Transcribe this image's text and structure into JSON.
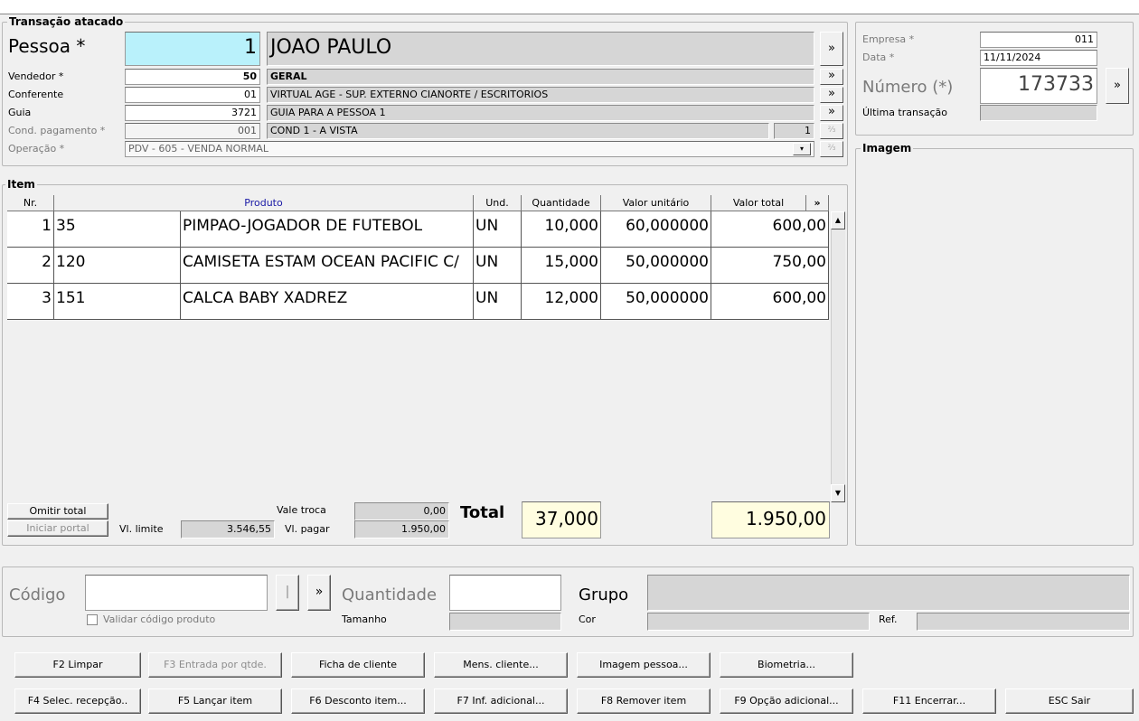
{
  "transacao": {
    "group_title": "Transação atacado",
    "pessoa": {
      "label": "Pessoa *",
      "code": "1",
      "name": "JOAO PAULO"
    },
    "vendedor": {
      "label": "Vendedor *",
      "code": "50",
      "name": "GERAL"
    },
    "conferente": {
      "label": "Conferente",
      "code": "01",
      "name": "VIRTUAL AGE - SUP. EXTERNO CIANORTE / ESCRITORIOS"
    },
    "guia": {
      "label": "Guia",
      "code": "3721",
      "name": "GUIA PARA A PESSOA 1"
    },
    "cond_pagamento": {
      "label": "Cond. pagamento *",
      "code": "001",
      "name": "COND 1 - A VISTA",
      "num": "1"
    },
    "operacao": {
      "label": "Operação *",
      "value": "PDV - 605 - VENDA NORMAL"
    },
    "more_symbol": "»"
  },
  "empresa_panel": {
    "empresa_label": "Empresa *",
    "empresa_value": "011",
    "data_label": "Data *",
    "data_value": "11/11/2024",
    "numero_label": "Número (*)",
    "numero_value": "173733",
    "ultima_label": "Última transação",
    "ultima_value": ""
  },
  "imagem": {
    "title": "Imagem"
  },
  "item": {
    "group_title": "Item",
    "columns": [
      "Nr.",
      "Produto",
      "Und.",
      "Quantidade",
      "Valor unitário",
      "Valor total",
      "»"
    ],
    "rows": [
      {
        "nr": "1",
        "code": "35",
        "desc": "PIMPAO-JOGADOR DE FUTEBOL",
        "und": "UN",
        "qtd": "10,000",
        "unit": "60,000000",
        "total": "600,00"
      },
      {
        "nr": "2",
        "code": "120",
        "desc": "CAMISETA ESTAM OCEAN PACIFIC C/",
        "und": "UN",
        "qtd": "15,000",
        "unit": "50,000000",
        "total": "750,00"
      },
      {
        "nr": "3",
        "code": "151",
        "desc": "CALCA BABY XADREZ",
        "und": "UN",
        "qtd": "12,000",
        "unit": "50,000000",
        "total": "600,00"
      }
    ]
  },
  "totals": {
    "omitir_total": "Omitir total",
    "iniciar_portal": "Iniciar portal",
    "vl_limite_label": "Vl. limite",
    "vl_limite_value": "3.546,55",
    "vale_troca_label": "Vale troca",
    "vale_troca_value": "0,00",
    "vl_pagar_label": "Vl. pagar",
    "vl_pagar_value": "1.950,00",
    "total_label": "Total",
    "total_qtd": "37,000",
    "total_valor": "1.950,00"
  },
  "entry": {
    "codigo_label": "Código",
    "codigo_value": "",
    "pipe_btn": "|",
    "more_btn": "»",
    "validar_label": "Validar código produto",
    "quantidade_label": "Quantidade",
    "quantidade_value": "",
    "tamanho_label": "Tamanho",
    "grupo_label": "Grupo",
    "cor_label": "Cor",
    "ref_label": "Ref."
  },
  "buttons_row1": [
    "F2 Limpar",
    "F3 Entrada por qtde.",
    "Ficha de cliente",
    "Mens. cliente...",
    "Imagem pessoa...",
    "Biometria..."
  ],
  "buttons_row2": [
    "F4 Selec. recepção..",
    "F5 Lançar item",
    "F6 Desconto item...",
    "F7 Inf. adicional...",
    "F8 Remover item",
    "F9 Opção adicional...",
    "F11 Encerrar...",
    "ESC Sair"
  ],
  "colors": {
    "highlight_field": "#b9f1fb",
    "total_field": "#fffde0",
    "readonly": "#d6d6d6"
  }
}
